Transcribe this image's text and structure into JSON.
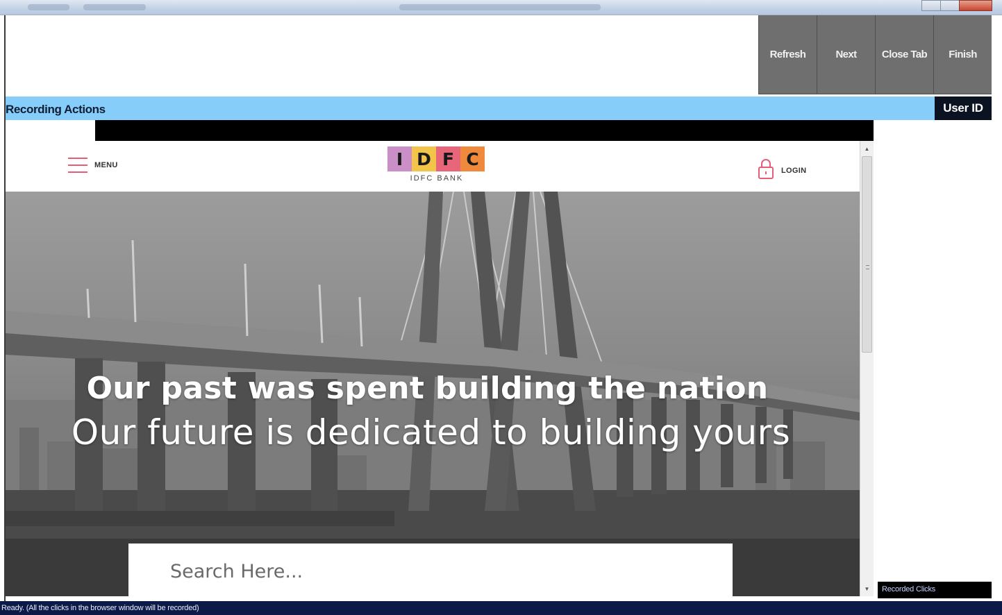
{
  "toolbar": {
    "refresh_label": "Refresh",
    "next_label": "Next",
    "close_tab_label": "Close Tab",
    "finish_label": "Finish"
  },
  "recording": {
    "label": "Recording Actions",
    "user_id_label": "User ID"
  },
  "site": {
    "menu_label": "MENU",
    "logo_letters": [
      "I",
      "D",
      "F",
      "C"
    ],
    "logo_colors": [
      "#c98fc6",
      "#f3c44a",
      "#e8667a",
      "#ef8a3c"
    ],
    "logo_subtitle": "IDFC BANK",
    "login_label": "LOGIN",
    "headline_1": "Our past was spent building the nation",
    "headline_2": "Our future is dedicated to building yours",
    "search_placeholder": "Search Here..."
  },
  "side_panel": {
    "recorded_clicks_label": "Recorded Clicks"
  },
  "status": {
    "text": "Ready. (All the clicks in the browser window will be recorded)"
  },
  "colors": {
    "accent_blue": "#87cdf9",
    "button_gray": "#6f6f6f",
    "status_navy": "#0b1a46",
    "menu_pink": "#e55d76"
  }
}
